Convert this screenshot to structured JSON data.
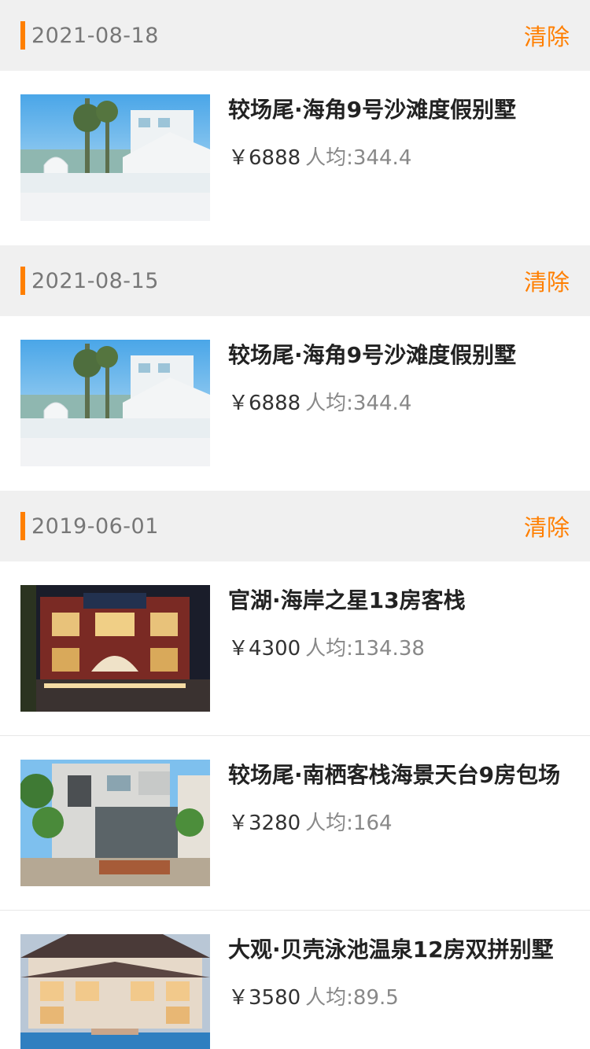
{
  "colors": {
    "accent": "#ff7f00",
    "header_bg": "#f0f0f0"
  },
  "groups": [
    {
      "date": "2021-08-18",
      "clear_label": "清除",
      "items": [
        {
          "title": "较场尾·海角9号沙滩度假别墅",
          "price": "￥6888",
          "per_person": "人均:344.4",
          "image": "seaside-villa"
        }
      ]
    },
    {
      "date": "2021-08-15",
      "clear_label": "清除",
      "items": [
        {
          "title": "较场尾·海角9号沙滩度假别墅",
          "price": "￥6888",
          "per_person": "人均:344.4",
          "image": "seaside-villa"
        }
      ]
    },
    {
      "date": "2019-06-01",
      "clear_label": "清除",
      "items": [
        {
          "title": "官湖·海岸之星13房客栈",
          "price": "￥4300",
          "per_person": "人均:134.38",
          "image": "night-inn"
        },
        {
          "title": "较场尾·南栖客栈海景天台9房包场",
          "price": "￥3280",
          "per_person": "人均:164",
          "image": "street-inn"
        },
        {
          "title": "大观·贝壳泳池温泉12房双拼别墅",
          "price": "￥3580",
          "per_person": "人均:89.5",
          "image": "pool-villa"
        }
      ]
    }
  ]
}
